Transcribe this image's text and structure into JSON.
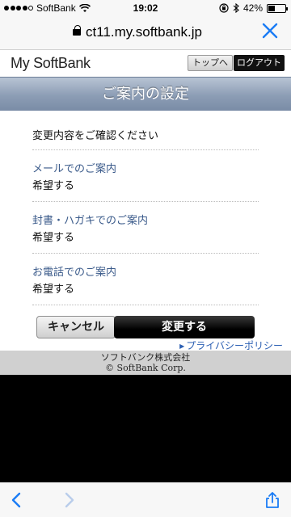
{
  "status": {
    "carrier": "SoftBank",
    "time": "19:02",
    "battery": "42%",
    "battery_level": 0.42
  },
  "browser": {
    "url": "ct11.my.softbank.jp"
  },
  "header": {
    "logo": "My SoftBank",
    "top_button": "トップへ",
    "logout_button": "ログアウト"
  },
  "page": {
    "title": "ご案内の設定",
    "confirm_text": "変更内容をご確認ください",
    "items": [
      {
        "label": "メールでのご案内",
        "value": "希望する"
      },
      {
        "label": "封書・ハガキでのご案内",
        "value": "希望する"
      },
      {
        "label": "お電話でのご案内",
        "value": "希望する"
      }
    ],
    "cancel_button": "キャンセル",
    "submit_button": "変更する",
    "privacy_link": "プライバシーポリシー"
  },
  "footer": {
    "company": "ソフトバンク株式会社",
    "copyright": "© SoftBank Corp."
  },
  "colors": {
    "link": "#2b5fb3",
    "label": "#3a5a8a",
    "title_bar": "#8c9db5",
    "ios_blue": "#1a7cf5"
  }
}
